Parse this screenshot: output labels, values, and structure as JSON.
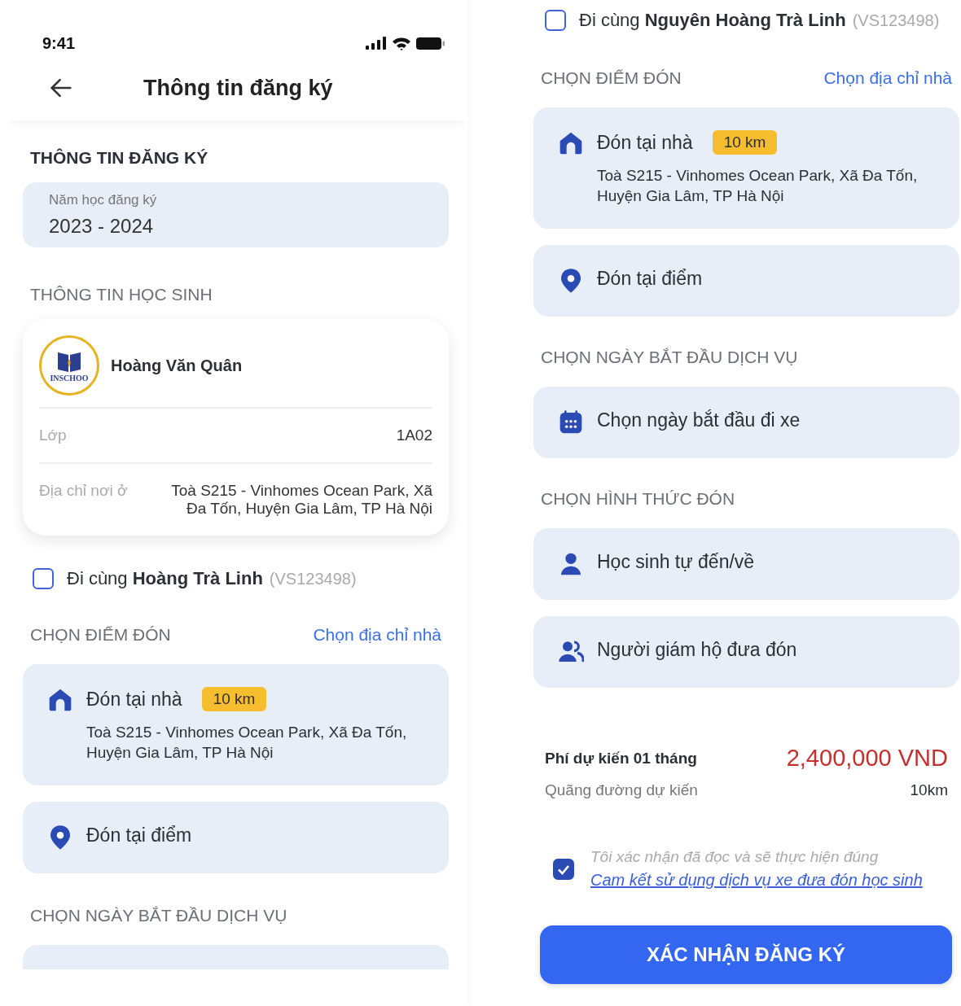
{
  "left_screen": {
    "status_bar": {
      "time": "9:41"
    },
    "header": {
      "title": "Thông tin đăng ký"
    },
    "registration": {
      "heading": "THÔNG TIN ĐĂNG KÝ",
      "field": {
        "label": "Năm học đăng ký",
        "value": "2023 - 2024"
      }
    },
    "student": {
      "heading": "THÔNG TIN HỌC SINH",
      "logo_text": "INSCHOO",
      "name": "Hoàng Văn Quân",
      "rows": [
        {
          "label": "Lớp",
          "value": "1A02"
        },
        {
          "label": "Địa chỉ nơi ở",
          "value": "Toà S215 - Vinhomes Ocean Park, Xã Đa Tốn, Huyện Gia Lâm, TP Hà Nội"
        }
      ]
    },
    "companion": {
      "text": "Đi cùng **Hoàng Trà Linh**",
      "code": "(VS123498)",
      "checked": false
    },
    "pickup": {
      "heading": "CHỌN ĐIỂM ĐÓN",
      "link": "Chọn địa chỉ nhà",
      "options": [
        {
          "kind": "home",
          "label": "Đón tại nhà",
          "badge": "10 km",
          "address": "Toà S215 - Vinhomes Ocean Park, Xã Đa Tốn, Huyện Gia Lâm, TP Hà Nội"
        },
        {
          "kind": "point",
          "label": "Đón tại điểm"
        }
      ]
    },
    "start_date": {
      "heading": "CHỌN NGÀY BẮT ĐẦU DỊCH VỤ"
    }
  },
  "right_screen": {
    "companion": {
      "text": "Đi cùng **Nguyên Hoàng Trà Linh**",
      "code": "(VS123498)",
      "checked": false
    },
    "pickup": {
      "heading": "CHỌN ĐIỂM ĐÓN",
      "link": "Chọn địa chỉ nhà",
      "options": [
        {
          "kind": "home",
          "label": "Đón tại nhà",
          "badge": "10 km",
          "address": "Toà S215 - Vinhomes Ocean Park, Xã Đa Tốn, Huyện Gia Lâm, TP Hà Nội"
        },
        {
          "kind": "point",
          "label": "Đón tại điểm"
        }
      ]
    },
    "start_date": {
      "heading": "CHỌN NGÀY BẮT ĐẦU DỊCH VỤ",
      "options": [
        {
          "kind": "calendar",
          "label": "Chọn ngày bắt đầu đi xe"
        }
      ]
    },
    "pickup_method": {
      "heading": "CHỌN HÌNH THỨC ĐÓN",
      "options": [
        {
          "kind": "person",
          "label": "Học sinh tự đến/về"
        },
        {
          "kind": "guardian",
          "label": "Người giám hộ đưa đón"
        }
      ]
    },
    "fee": {
      "label": "Phí dự kiến 01 tháng",
      "value": "2,400,000 VND",
      "distance_label": "Quãng đường dự kiến",
      "distance_value": "10km"
    },
    "agreement": {
      "checked": true,
      "text": "Tôi xác nhận đã đọc và sẽ thực hiện đúng",
      "link": "Cam kết sử dụng dịch vụ xe đưa đón học sinh"
    },
    "submit": {
      "label": "XÁC NHẬN ĐĂNG KÝ"
    }
  }
}
